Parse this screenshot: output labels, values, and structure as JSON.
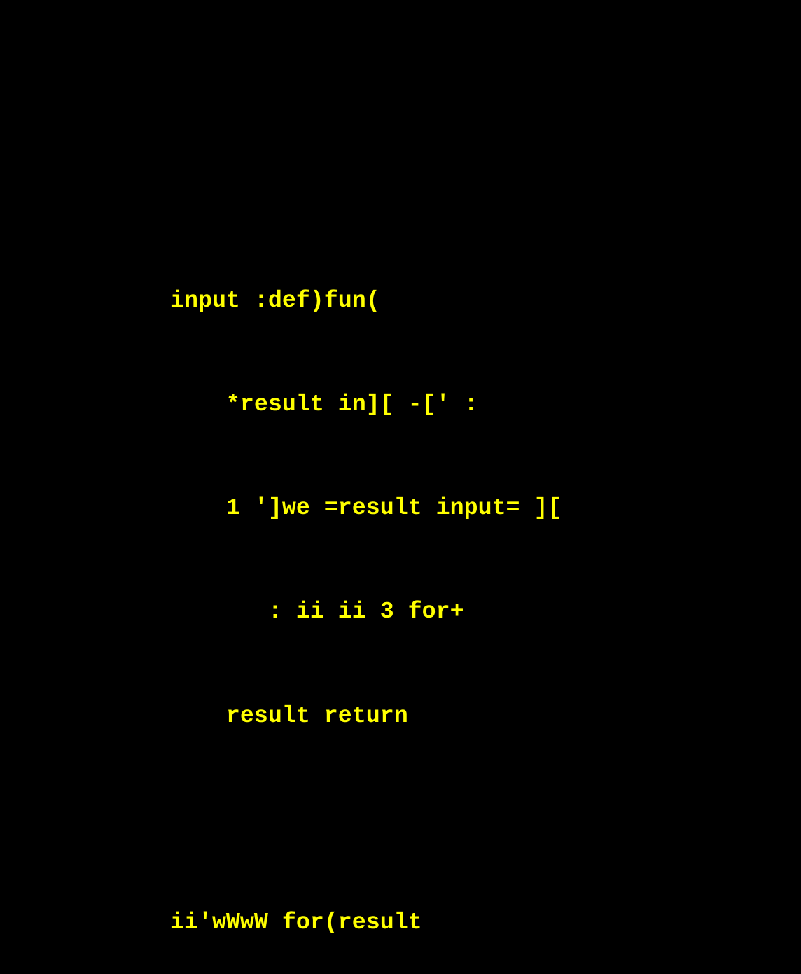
{
  "code": {
    "text_color": "#ffff00",
    "background_color": "#000000",
    "lines": [
      "input :def)fun(",
      "    *result in][ -[' :",
      "    1 ']we =result input= ][",
      "       : ii ii 3 for+",
      "    result return",
      "ii'wWwW for(result"
    ]
  }
}
